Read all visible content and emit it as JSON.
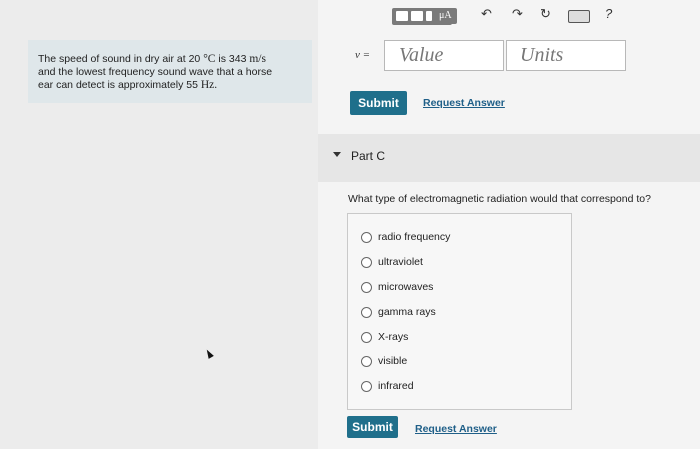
{
  "problem": {
    "line1_prefix": "The speed of sound in dry air at 20",
    "line1_temp_unit": "°C",
    "line1_mid": "is 343",
    "line1_speed_unit": "m/s",
    "line2": "and the lowest frequency sound wave that a horse",
    "line3_prefix": "ear can detect is approximately 55",
    "line3_unit": "Hz."
  },
  "toolbar": {
    "mua_label": "μA",
    "undo_icon": "↶",
    "redo_icon": "↷",
    "reset_icon": "↻",
    "help_icon": "?"
  },
  "answer": {
    "variable_label": "ν =",
    "value_placeholder": "Value",
    "units_placeholder": "Units",
    "submit_label": "Submit",
    "request_label": "Request Answer"
  },
  "part_c": {
    "title": "Part C",
    "question": "What type of electromagnetic radiation would that correspond to?",
    "options": [
      "radio frequency",
      "ultraviolet",
      "microwaves",
      "gamma rays",
      "X-rays",
      "visible",
      "infrared"
    ],
    "submit_label": "Submit",
    "request_label": "Request Answer"
  },
  "colors": {
    "accent": "#1f6f8b",
    "link": "#1f5f88",
    "problem_bg": "#dfe7ea"
  }
}
